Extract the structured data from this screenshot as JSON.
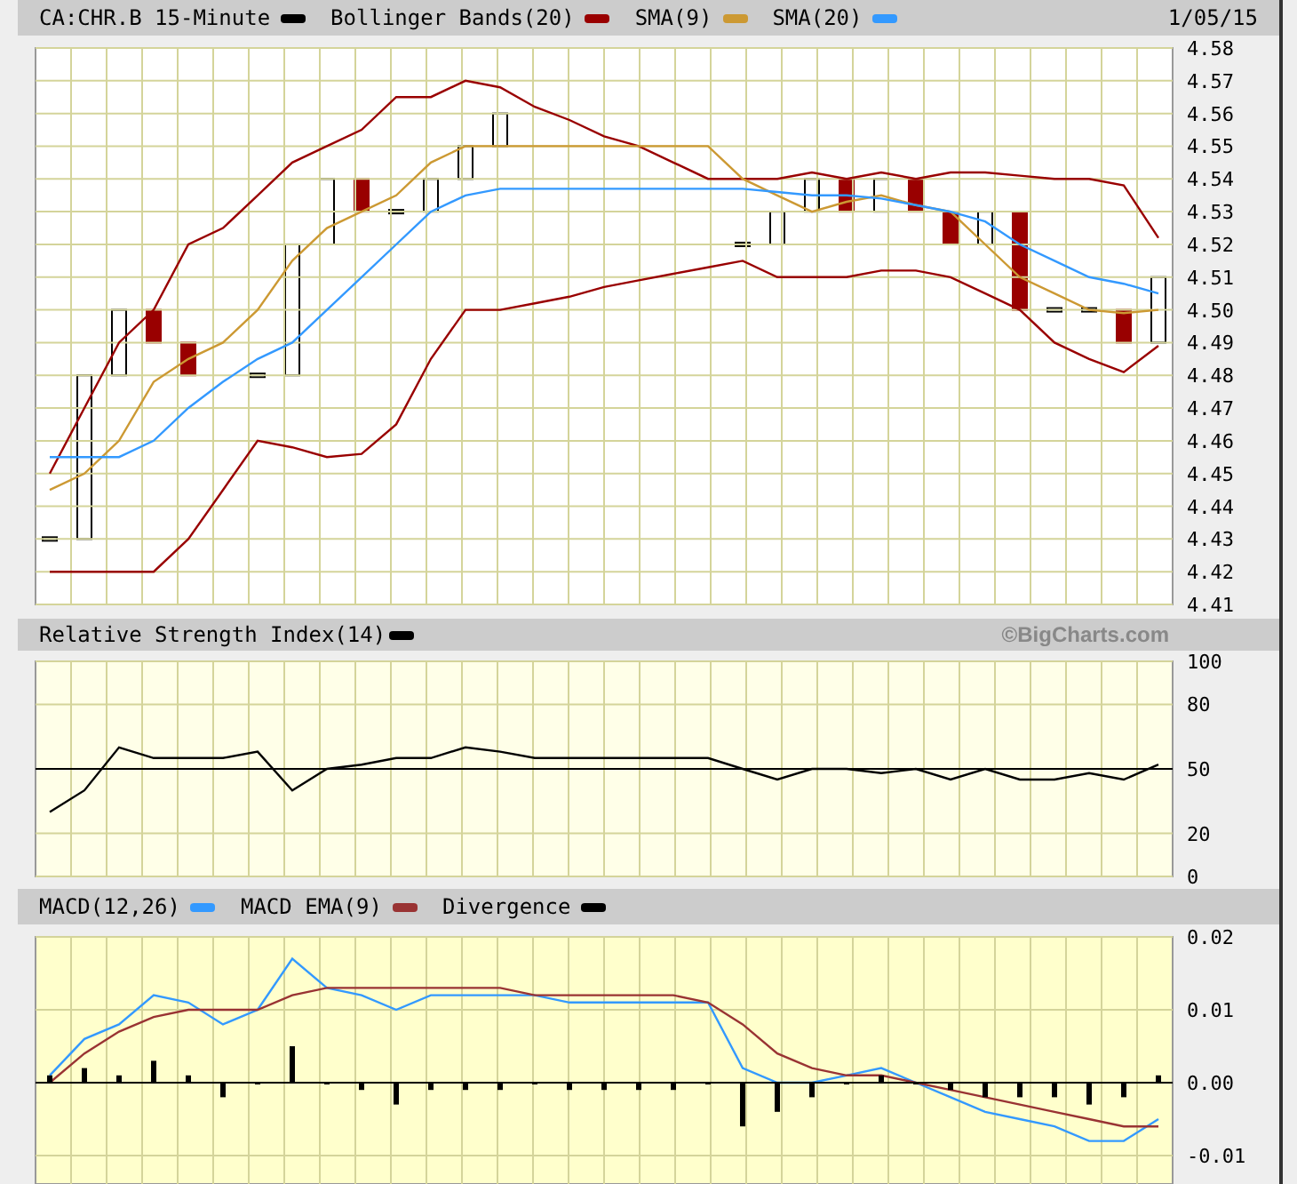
{
  "header": {
    "date": "1/05/15"
  },
  "price_panel": {
    "symbol": {
      "label": "CA:CHR.B 15-Minute",
      "color": "#000000"
    },
    "chart_data": {
      "type": "line",
      "grid": true,
      "ylim": [
        4.41,
        4.58
      ],
      "yticks": [
        {
          "value": 4.41,
          "label": "4.41"
        },
        {
          "value": 4.42,
          "label": "4.42"
        },
        {
          "value": 4.43,
          "label": "4.43"
        },
        {
          "value": 4.44,
          "label": "4.44"
        },
        {
          "value": 4.45,
          "label": "4.45"
        },
        {
          "value": 4.46,
          "label": "4.46"
        },
        {
          "value": 4.47,
          "label": "4.47"
        },
        {
          "value": 4.48,
          "label": "4.48"
        },
        {
          "value": 4.49,
          "label": "4.49"
        },
        {
          "value": 4.5,
          "label": "4.50"
        },
        {
          "value": 4.51,
          "label": "4.51"
        },
        {
          "value": 4.52,
          "label": "4.52"
        },
        {
          "value": 4.53,
          "label": "4.53"
        },
        {
          "value": 4.54,
          "label": "4.54"
        },
        {
          "value": 4.55,
          "label": "4.55"
        },
        {
          "value": 4.56,
          "label": "4.56"
        },
        {
          "value": 4.57,
          "label": "4.57"
        },
        {
          "value": 4.58,
          "label": "4.58"
        }
      ],
      "series": [
        {
          "name": "Bollinger Bands(20)",
          "color": "#990000",
          "values": [
            4.45,
            4.47,
            4.49,
            4.5,
            4.52,
            4.525,
            4.535,
            4.545,
            4.55,
            4.555,
            4.565,
            4.565,
            4.57,
            4.568,
            4.562,
            4.558,
            4.553,
            4.55,
            4.545,
            4.54,
            4.54,
            4.54,
            4.542,
            4.54,
            4.542,
            4.54,
            4.542,
            4.542,
            4.541,
            4.54,
            4.54,
            4.538,
            4.522
          ]
        },
        {
          "color": "#990000",
          "values": [
            4.42,
            4.42,
            4.42,
            4.42,
            4.43,
            4.445,
            4.46,
            4.458,
            4.455,
            4.456,
            4.465,
            4.485,
            4.5,
            4.5,
            4.502,
            4.504,
            4.507,
            4.509,
            4.511,
            4.513,
            4.515,
            4.51,
            4.51,
            4.51,
            4.512,
            4.512,
            4.51,
            4.505,
            4.5,
            4.49,
            4.485,
            4.481,
            4.489
          ]
        },
        {
          "name": "SMA(9)",
          "color": "#cc9933",
          "values": [
            4.445,
            4.45,
            4.46,
            4.478,
            4.485,
            4.49,
            4.5,
            4.515,
            4.525,
            4.53,
            4.535,
            4.545,
            4.55,
            4.55,
            4.55,
            4.55,
            4.55,
            4.55,
            4.55,
            4.55,
            4.54,
            4.535,
            4.53,
            4.533,
            4.535,
            4.532,
            4.53,
            4.52,
            4.51,
            4.505,
            4.5,
            4.499,
            4.5
          ]
        },
        {
          "name": "SMA(20)",
          "color": "#3399ff",
          "values": [
            4.455,
            4.455,
            4.455,
            4.46,
            4.47,
            4.478,
            4.485,
            4.49,
            4.5,
            4.51,
            4.52,
            4.53,
            4.535,
            4.537,
            4.537,
            4.537,
            4.537,
            4.537,
            4.537,
            4.537,
            4.537,
            4.536,
            4.535,
            4.535,
            4.534,
            4.532,
            4.53,
            4.527,
            4.52,
            4.515,
            4.51,
            4.508,
            4.505
          ]
        }
      ]
    }
  },
  "rsi_panel": {
    "credit": "©BigCharts.com",
    "chart_data": {
      "type": "line",
      "grid": true,
      "ylim": [
        0,
        100
      ],
      "yticks": [
        0,
        20,
        50,
        80,
        100
      ],
      "series": [
        {
          "name": "Relative Strength Index(14)",
          "color": "#000000",
          "values": [
            30,
            40,
            60,
            55,
            55,
            55,
            58,
            40,
            50,
            52,
            55,
            55,
            60,
            58,
            55,
            55,
            55,
            55,
            55,
            55,
            50,
            45,
            50,
            50,
            48,
            50,
            45,
            50,
            45,
            45,
            48,
            45,
            52
          ]
        }
      ]
    }
  },
  "macd_panel": {
    "chart_data": {
      "type": "line",
      "grid": true,
      "ylim": [
        -0.014,
        0.02
      ],
      "yticks": [
        {
          "value": -0.01,
          "label": "-0.01"
        },
        {
          "value": 0,
          "label": "0.00"
        },
        {
          "value": 0.01,
          "label": "0.01"
        },
        {
          "value": 0.02,
          "label": "0.02"
        }
      ],
      "series": [
        {
          "name": "MACD(12,26)",
          "color": "#3399ff",
          "values": [
            0.001,
            0.006,
            0.008,
            0.012,
            0.011,
            0.008,
            0.01,
            0.017,
            0.013,
            0.012,
            0.01,
            0.012,
            0.012,
            0.012,
            0.012,
            0.011,
            0.011,
            0.011,
            0.011,
            0.011,
            0.002,
            0,
            0,
            0.001,
            0.002,
            0,
            -0.002,
            -0.004,
            -0.005,
            -0.006,
            -0.008,
            -0.008,
            -0.005
          ]
        },
        {
          "name": "MACD EMA(9)",
          "color": "#993333",
          "values": [
            0,
            0.004,
            0.007,
            0.009,
            0.01,
            0.01,
            0.01,
            0.012,
            0.013,
            0.013,
            0.013,
            0.013,
            0.013,
            0.013,
            0.012,
            0.012,
            0.012,
            0.012,
            0.012,
            0.011,
            0.008,
            0.004,
            0.002,
            0.001,
            0.001,
            0,
            -0.001,
            -0.002,
            -0.003,
            -0.004,
            -0.005,
            -0.006,
            -0.006
          ]
        },
        {
          "name": "Divergence",
          "color": "#000000",
          "type": "bar",
          "values": [
            0.001,
            0.002,
            0.001,
            0.003,
            0.001,
            -0.002,
            0,
            0.005,
            0,
            -0.001,
            -0.003,
            -0.001,
            -0.001,
            -0.001,
            0,
            -0.001,
            -0.001,
            -0.001,
            -0.001,
            0,
            -0.006,
            -0.004,
            -0.002,
            0,
            0.001,
            0,
            -0.001,
            -0.002,
            -0.002,
            -0.002,
            -0.003,
            -0.002,
            0.001
          ]
        }
      ]
    }
  }
}
